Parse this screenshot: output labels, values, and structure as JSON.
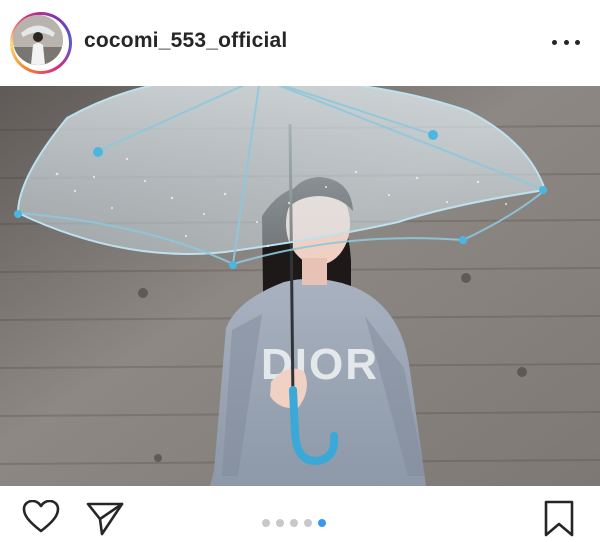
{
  "post": {
    "username": "cocomi_553_official",
    "photo_caption_text": "DIOR",
    "carousel": {
      "total": 5,
      "active_index": 4
    }
  },
  "colors": {
    "active_dot": "#3897f0",
    "inactive_dot": "#c8c8c8",
    "text": "#262626",
    "umbrella_handle": "#3aa9d8"
  },
  "icons": {
    "avatar": "profile-photo",
    "more": "more-horizontal-icon",
    "like": "heart-icon",
    "share": "paper-plane-icon",
    "save": "bookmark-icon"
  }
}
